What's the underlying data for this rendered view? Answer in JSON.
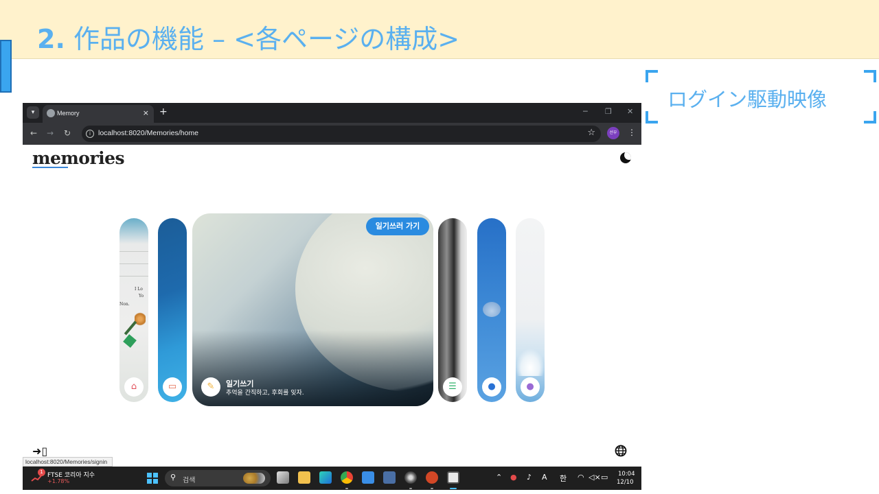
{
  "slide": {
    "title_number": "2.",
    "title_text": "作品の機能 – <各ページの構成>",
    "callout_text": "ログイン駆動映像"
  },
  "browser": {
    "tab_title": "Memory",
    "tab_close": "×",
    "new_tab": "+",
    "url": "localhost:8020/Memories/home",
    "profile_initials": "선우",
    "status_url": "localhost:8020/Memories/signin"
  },
  "page": {
    "logo": "memories",
    "diary_button": "일기쓰러 가기",
    "diary_title": "일기쓰기",
    "diary_subtitle": "추억을 간직하고, 후회를 잊자.",
    "card_left_texts": [
      "I Lo",
      "Yo",
      "Non."
    ],
    "cards": [
      {
        "icon": "home-icon",
        "glyph": "⌂"
      },
      {
        "icon": "id-card-icon",
        "glyph": "▭"
      },
      {
        "icon": "pencil-icon",
        "glyph": "✎"
      },
      {
        "icon": "list-icon",
        "glyph": "☰"
      },
      {
        "icon": "chat-icon",
        "glyph": "●"
      },
      {
        "icon": "user-icon",
        "glyph": "●"
      }
    ]
  },
  "taskbar": {
    "widget_badge": "1",
    "widget_name": "FTSE 코리아 지수",
    "widget_value": "+1.78%",
    "search_placeholder": "검색",
    "tray_language": "A",
    "tray_ime": "한",
    "time": "10:04",
    "date": "12/10"
  },
  "colors": {
    "accent": "#5ab0ef",
    "title_band": "#fff2cc",
    "diary_button": "#2a8be0"
  }
}
